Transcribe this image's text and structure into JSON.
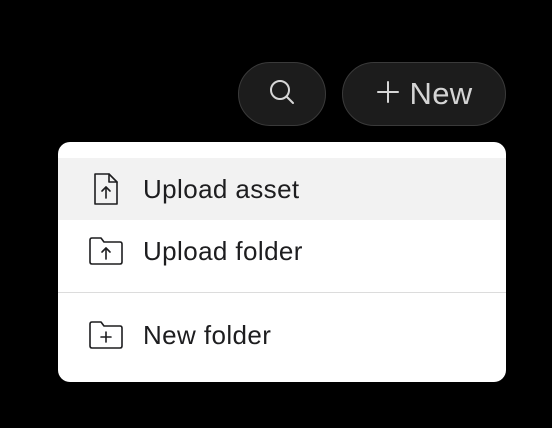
{
  "toolbar": {
    "search_icon": "search-icon",
    "new_button": {
      "icon": "plus-icon",
      "label": "New"
    }
  },
  "menu": {
    "items": [
      {
        "label": "Upload asset",
        "icon": "file-upload-icon",
        "highlighted": true
      },
      {
        "label": "Upload folder",
        "icon": "folder-upload-icon",
        "highlighted": false
      },
      {
        "label": "New folder",
        "icon": "folder-plus-icon",
        "highlighted": false
      }
    ]
  },
  "colors": {
    "background": "#000000",
    "button_bg": "#1c1c1c",
    "button_border": "#3a3a3a",
    "menu_bg": "#ffffff",
    "menu_hover": "#f2f2f2",
    "text": "#1d1d1f"
  }
}
